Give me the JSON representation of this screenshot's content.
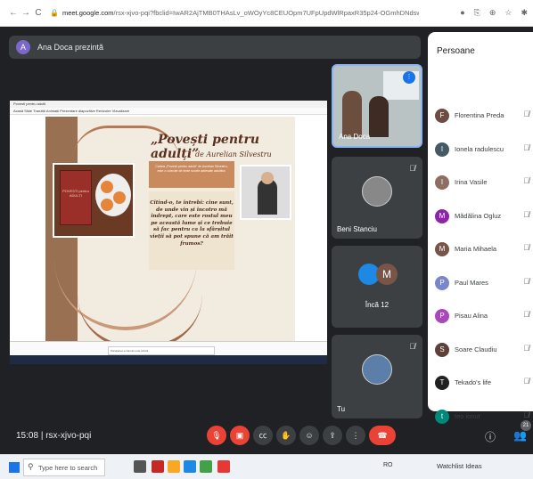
{
  "browser": {
    "url_host": "meet.google.com",
    "url_path": "/rsx-xjvo-pqi?fbclid=IwAR2AjTMB0THAsLv_oWOyYc8CEUOpm7UFpUpdWlRpaxR35p24-OGmhDNdsw",
    "nav": [
      "←",
      "→",
      "C"
    ],
    "icons": [
      "●",
      "⎘",
      "⊕",
      "☆",
      "✱"
    ]
  },
  "meet": {
    "presenter_initial": "A",
    "presenting_label": "Ana Doca prezintă",
    "slide": {
      "title": "„Povești pentru adulți”",
      "subtitle": "de Aurelian Silvestru",
      "description": "Cartea „Povești pentru adulți” de Aurelian Silvestru, este o colecție de texte scurte adresate adultilor.",
      "book_cover_text": "POVEȘTI pentru ADULȚI",
      "quote": "Citind-o, te întrebi: cine sunt, de unde vin și încotro mă îndrept, care este rostul meu pe această lume și ce trebuie să fac pentru ca la sfârșitul vieții să pot spune că am trăit frumos?",
      "window_title": "Povesti pentru adulti",
      "menu": "Acasă   Slide   Tranziții   Animații   Prezentare diapozitive   Revizuire   Vizualizare",
      "notification": "Partajarea ecranului este activă"
    },
    "tiles": [
      {
        "name": "Ana Doca"
      },
      {
        "name": "Beni Stanciu"
      },
      {
        "name": "Încă 12",
        "avatar_initial": "M"
      },
      {
        "name": "Tu"
      }
    ],
    "people_panel": {
      "title": "Persoane",
      "participants": [
        {
          "name": "Florentina Preda",
          "initial": "F",
          "color": "#6d4c41"
        },
        {
          "name": "Ionela radulescu",
          "initial": "I",
          "color": "#455a64"
        },
        {
          "name": "Irina Vasile",
          "initial": "I",
          "color": "#8d6e63"
        },
        {
          "name": "Mădălina Ogluz",
          "initial": "M",
          "color": "#8e24aa"
        },
        {
          "name": "Maria Mihaela",
          "initial": "M",
          "color": "#795548"
        },
        {
          "name": "Paul Mares",
          "initial": "P",
          "color": "#7986cb"
        },
        {
          "name": "Pisau Alina",
          "initial": "P",
          "color": "#ab47bc"
        },
        {
          "name": "Soare Claudiu",
          "initial": "S",
          "color": "#5d4037"
        },
        {
          "name": "Tekado's life",
          "initial": "T",
          "color": "#212121"
        },
        {
          "name": "teo ionut",
          "initial": "t",
          "color": "#00897b"
        }
      ]
    },
    "bottom": {
      "time": "15:08",
      "separator": "|",
      "meeting_code": "rsx-xjvo-pqi",
      "participant_count": "21",
      "controls": [
        "mic-off",
        "cam-off",
        "captions",
        "raise-hand",
        "emoji",
        "present",
        "more",
        "end-call"
      ]
    }
  },
  "taskbar": {
    "search_placeholder": "Type here to search",
    "tray_app": "Watchlist Ideas",
    "tray_left": "RO"
  },
  "colors": {
    "meet_bg": "#202124",
    "tile_bg": "#3c4043",
    "end_call": "#ea4335",
    "accent": "#8ab4f8"
  }
}
